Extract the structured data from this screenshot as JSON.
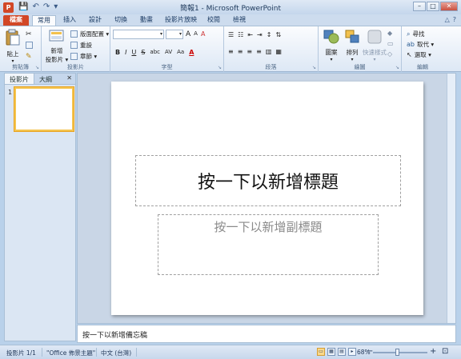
{
  "titlebar": {
    "app_icon": "P",
    "qat": {
      "save_icon": "💾",
      "undo_icon": "↶",
      "redo_icon": "↷",
      "customize_icon": "▾"
    },
    "title": "簡報1 - Microsoft PowerPoint",
    "window_buttons": {
      "minimize": "–",
      "maximize": "□",
      "close": "✕"
    }
  },
  "ribbon_tabs": {
    "file": "檔案",
    "tabs": [
      "常用",
      "插入",
      "設計",
      "切換",
      "動畫",
      "投影片放映",
      "校閱",
      "檢視"
    ],
    "right": {
      "collapse": "△",
      "help": "?"
    }
  },
  "ribbon": {
    "clipboard": {
      "paste": "貼上",
      "label": "剪貼簿"
    },
    "slides": {
      "new_slide_line1": "新增",
      "new_slide_line2": "投影片 ▾",
      "layout": "版面配置 ▾",
      "reset": "重設",
      "section": "章節 ▾",
      "label": "投影片"
    },
    "font": {
      "bold": "B",
      "italic": "I",
      "underline": "U",
      "strike": "S",
      "shadow": "abc",
      "spacing": "AV",
      "case": "Aa",
      "grow": "A",
      "shrink": "A",
      "clear": "A",
      "label": "字型"
    },
    "paragraph": {
      "label": "段落"
    },
    "drawing": {
      "shapes": "圖案",
      "arrange": "排列",
      "quick_styles": "快速樣式",
      "label": "繪圖"
    },
    "editing": {
      "find": "尋找",
      "replace": "取代 ▾",
      "select": "選取 ▾",
      "label": "編輯"
    }
  },
  "leftpane": {
    "tab_slides": "投影片",
    "tab_outline": "大綱",
    "close": "✕",
    "slide_number": "1"
  },
  "slide": {
    "title_placeholder": "按一下以新增標題",
    "subtitle_placeholder": "按一下以新增副標題"
  },
  "notes": {
    "placeholder": "按一下以新增備忘稿"
  },
  "statusbar": {
    "slide_count": "投影片 1/1",
    "theme": "\"Office 佈景主題\"",
    "language": "中文 (台灣)",
    "zoom": "68%",
    "zoom_out": "−",
    "zoom_in": "+"
  }
}
